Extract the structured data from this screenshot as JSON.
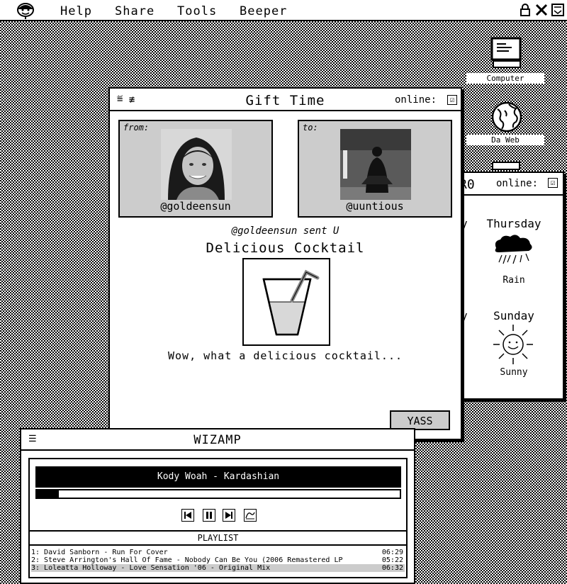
{
  "menubar": {
    "items": [
      "Help",
      "Share",
      "Tools",
      "Beeper"
    ]
  },
  "desktop": {
    "icons": [
      {
        "label": "Computer",
        "icon": "computer-icon"
      },
      {
        "label": "Da Web",
        "icon": "globe-icon"
      }
    ]
  },
  "gift_window": {
    "title": "Gift Time",
    "online_label": "online:",
    "checkbox_mark": "☑",
    "from_label": "from:",
    "to_label": "to:",
    "from_handle": "@goldeensun",
    "to_handle": "@uuntious",
    "sent_text": "@goldeensun sent U",
    "item_name": "Delicious Cocktail",
    "item_icon": "cocktail-icon",
    "message": "Wow, what a delicious cocktail...",
    "button": "YASS"
  },
  "weather_window": {
    "title_fragment": "R0",
    "online_label": "online:",
    "checkbox_mark": "☑",
    "days": [
      {
        "day": "Thursday",
        "condition": "Rain",
        "icon": "rain-cloud-icon"
      },
      {
        "day": "Sunday",
        "condition": "Sunny",
        "icon": "sun-icon"
      }
    ],
    "left_fragments": [
      "y",
      "y"
    ]
  },
  "wizamp": {
    "title": "WIZAMP",
    "now_playing": "Kody Woah - Kardashian",
    "progress": 0.06,
    "playlist_header": "PLAYLIST",
    "playlist": [
      {
        "title": "1: David Sanborn - Run For Cover",
        "duration": "06:29"
      },
      {
        "title": "2: Steve Arrington's Hall Of Fame - Nobody Can Be You (2006 Remastered LP",
        "duration": "05:22"
      },
      {
        "title": "3: Loleatta Holloway - Love Sensation '06 - Original Mix",
        "duration": "06:32"
      }
    ]
  }
}
